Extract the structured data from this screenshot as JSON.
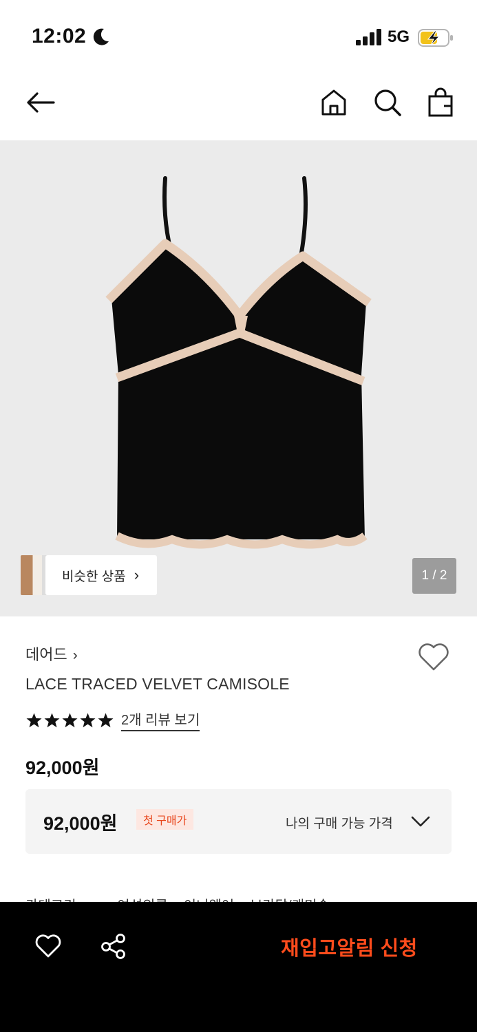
{
  "status_bar": {
    "time": "12:02",
    "network": "5G"
  },
  "nav": {
    "icons": [
      "back-icon",
      "home-icon",
      "search-icon",
      "bag-icon"
    ]
  },
  "hero": {
    "similar_label": "비슷한 상품",
    "similar_chevron": "›",
    "counter": "1 / 2"
  },
  "product": {
    "brand": "데어드",
    "brand_chevron": "›",
    "name": "LACE TRACED VELVET CAMISOLE",
    "rating": 5,
    "review_link": "2개 리뷰 보기",
    "price": "92,000원"
  },
  "price_box": {
    "amount": "92,000원",
    "badge": "첫 구매가",
    "my_price_label": "나의 구매 가능 가격"
  },
  "category": {
    "label": "카테고리",
    "path": "여성의류 > 이너웨어 > 브라탑/캐미솔"
  },
  "bottom_bar": {
    "restock_label": "재입고알림 신청"
  },
  "colors": {
    "accent": "#ff4c1c",
    "badge_bg": "#fde7e1",
    "badge_text": "#e8471d"
  }
}
